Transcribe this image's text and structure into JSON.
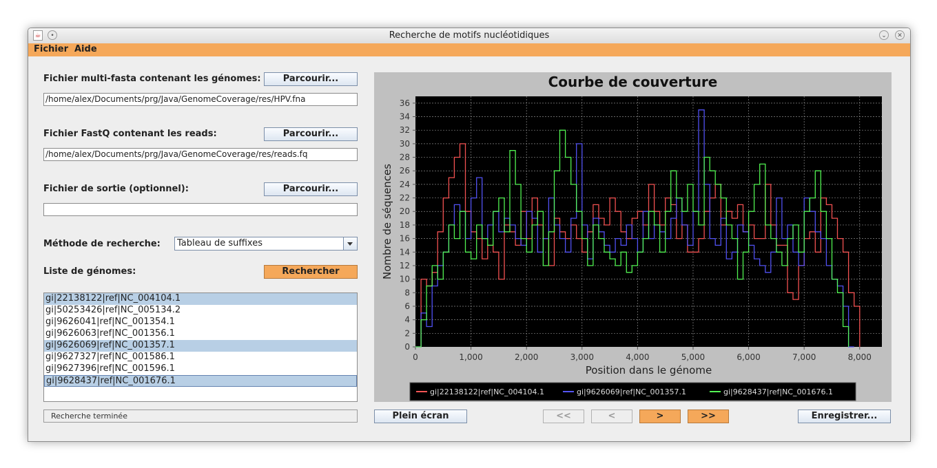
{
  "window": {
    "title": "Recherche de motifs nucléotidiques"
  },
  "menu": {
    "items": [
      "Fichier",
      "Aide"
    ]
  },
  "form": {
    "genomes_label": "Fichier multi-fasta contenant les génomes:",
    "genomes_path": "/home/alex/Documents/prg/Java/GenomeCoverage/res/HPV.fna",
    "reads_label": "Fichier FastQ contenant les reads:",
    "reads_path": "/home/alex/Documents/prg/Java/GenomeCoverage/res/reads.fq",
    "output_label": "Fichier de sortie (optionnel):",
    "output_path": "",
    "browse_label": "Parcourir...",
    "method_label": "Méthode de recherche:",
    "method_value": "Tableau de suffixes",
    "list_label": "Liste de génomes:",
    "search_label": "Rechercher"
  },
  "genomes": [
    {
      "name": "gi|22138122|ref|NC_004104.1",
      "selected": true
    },
    {
      "name": "gi|50253426|ref|NC_005134.2",
      "selected": false
    },
    {
      "name": "gi|9626041|ref|NC_001354.1",
      "selected": false
    },
    {
      "name": "gi|9626063|ref|NC_001356.1",
      "selected": false
    },
    {
      "name": "gi|9626069|ref|NC_001357.1",
      "selected": true
    },
    {
      "name": "gi|9627327|ref|NC_001586.1",
      "selected": false
    },
    {
      "name": "gi|9627396|ref|NC_001596.1",
      "selected": false
    },
    {
      "name": "gi|9628437|ref|NC_001676.1",
      "selected": true,
      "focused": true
    }
  ],
  "status": "Recherche terminée",
  "bottom": {
    "fullscreen_label": "Plein écran",
    "first_label": "<<",
    "prev_label": "<",
    "next_label": ">",
    "last_label": ">>",
    "save_label": "Enregistrer..."
  },
  "colors": {
    "accent": "#f5a85a",
    "series_red": "#ff5555",
    "series_blue": "#5555ff",
    "series_green": "#55ff55",
    "plot_bg": "#000000"
  },
  "chart_data": {
    "type": "line",
    "title": "Courbe de couverture",
    "xlabel": "Position dans le génome",
    "ylabel": "Nombre de séquences",
    "xlim": [
      0,
      8400
    ],
    "ylim": [
      0,
      37
    ],
    "xticks": [
      "0",
      "1,000",
      "2,000",
      "3,000",
      "4,000",
      "5,000",
      "6,000",
      "7,000",
      "8,000"
    ],
    "yticks": [
      "0",
      "2",
      "4",
      "6",
      "8",
      "10",
      "12",
      "14",
      "16",
      "18",
      "20",
      "22",
      "24",
      "26",
      "28",
      "30",
      "32",
      "34",
      "36"
    ],
    "grid": true,
    "legend_position": "bottom",
    "series": [
      {
        "name": "gi|22138122|ref|NC_004104.1",
        "color": "#ff5555",
        "x": [
          0,
          100,
          200,
          300,
          400,
          500,
          600,
          700,
          800,
          900,
          1000,
          1100,
          1200,
          1300,
          1400,
          1500,
          1600,
          1700,
          1800,
          1900,
          2000,
          2100,
          2200,
          2300,
          2400,
          2500,
          2600,
          2700,
          2800,
          2900,
          3000,
          3100,
          3200,
          3300,
          3400,
          3500,
          3600,
          3700,
          3800,
          3900,
          4000,
          4100,
          4200,
          4300,
          4400,
          4500,
          4600,
          4700,
          4800,
          4900,
          5000,
          5100,
          5200,
          5300,
          5400,
          5500,
          5600,
          5700,
          5800,
          5900,
          6000,
          6100,
          6200,
          6300,
          6400,
          6500,
          6600,
          6700,
          6800,
          6900,
          7000,
          7100,
          7200,
          7300,
          7400,
          7500,
          7600,
          7700,
          7800,
          7900,
          8000
        ],
        "y": [
          0,
          10,
          9,
          11,
          17,
          22,
          25,
          28,
          30,
          20,
          17,
          16,
          13,
          15,
          14,
          10,
          18,
          17,
          15,
          20,
          16,
          22,
          18,
          16,
          12,
          19,
          17,
          16,
          18,
          16,
          14,
          17,
          21,
          19,
          18,
          22,
          20,
          17,
          16,
          19,
          20,
          18,
          24,
          20,
          18,
          22,
          21,
          16,
          18,
          14,
          14,
          16,
          20,
          22,
          24,
          18,
          20,
          19,
          21,
          17,
          18,
          16,
          16,
          24,
          18,
          15,
          15,
          8,
          7,
          12,
          16,
          17,
          14,
          22,
          21,
          19,
          16,
          14,
          8,
          6,
          0
        ]
      },
      {
        "name": "gi|9626069|ref|NC_001357.1",
        "color": "#5555ff",
        "x": [
          0,
          100,
          200,
          300,
          400,
          500,
          600,
          700,
          800,
          900,
          1000,
          1100,
          1200,
          1300,
          1400,
          1500,
          1600,
          1700,
          1800,
          1900,
          2000,
          2100,
          2200,
          2300,
          2400,
          2500,
          2600,
          2700,
          2800,
          2900,
          3000,
          3100,
          3200,
          3300,
          3400,
          3500,
          3600,
          3700,
          3800,
          3900,
          4000,
          4100,
          4200,
          4300,
          4400,
          4500,
          4600,
          4700,
          4800,
          4900,
          5000,
          5100,
          5200,
          5300,
          5400,
          5500,
          5600,
          5700,
          5800,
          5900,
          6000,
          6100,
          6200,
          6300,
          6400,
          6500,
          6600,
          6700,
          6800,
          6900,
          7000,
          7100,
          7200,
          7300,
          7400,
          7500,
          7600,
          7700,
          7800,
          7900
        ],
        "y": [
          0,
          5,
          3,
          9,
          12,
          14,
          18,
          21,
          20,
          16,
          22,
          25,
          16,
          18,
          20,
          17,
          19,
          18,
          16,
          15,
          20,
          19,
          14,
          16,
          22,
          18,
          16,
          14,
          19,
          30,
          18,
          13,
          19,
          17,
          15,
          14,
          16,
          15,
          18,
          16,
          14,
          20,
          16,
          18,
          17,
          16,
          19,
          22,
          18,
          15,
          20,
          35,
          24,
          16,
          15,
          19,
          13,
          14,
          18,
          17,
          15,
          13,
          12,
          11,
          14,
          22,
          16,
          18,
          14,
          12,
          22,
          20,
          17,
          16,
          12,
          10,
          9,
          6,
          0,
          0
        ]
      },
      {
        "name": "gi|9628437|ref|NC_001676.1",
        "color": "#55ff55",
        "x": [
          0,
          100,
          200,
          300,
          400,
          500,
          600,
          700,
          800,
          900,
          1000,
          1100,
          1200,
          1300,
          1400,
          1500,
          1600,
          1700,
          1800,
          1900,
          2000,
          2100,
          2200,
          2300,
          2400,
          2500,
          2600,
          2700,
          2800,
          2900,
          3000,
          3100,
          3200,
          3300,
          3400,
          3500,
          3600,
          3700,
          3800,
          3900,
          4000,
          4100,
          4200,
          4300,
          4400,
          4500,
          4600,
          4700,
          4800,
          4900,
          5000,
          5100,
          5200,
          5300,
          5400,
          5500,
          5600,
          5700,
          5800,
          5900,
          6000,
          6100,
          6200,
          6300,
          6400,
          6500,
          6600,
          6700,
          6800,
          6900,
          7000,
          7100,
          7200,
          7300,
          7400,
          7500,
          7600,
          7700,
          7800
        ],
        "y": [
          0,
          4,
          9,
          12,
          10,
          14,
          18,
          16,
          20,
          14,
          13,
          18,
          16,
          15,
          20,
          22,
          17,
          29,
          24,
          16,
          14,
          18,
          20,
          12,
          17,
          26,
          32,
          28,
          24,
          20,
          16,
          12,
          18,
          16,
          14,
          13,
          12,
          14,
          11,
          12,
          14,
          16,
          20,
          18,
          14,
          20,
          26,
          22,
          20,
          24,
          20,
          18,
          28,
          26,
          24,
          22,
          18,
          16,
          10,
          14,
          20,
          24,
          27,
          18,
          16,
          14,
          12,
          16,
          18,
          14,
          20,
          22,
          26,
          20,
          16,
          10,
          8,
          3,
          0
        ]
      }
    ]
  }
}
